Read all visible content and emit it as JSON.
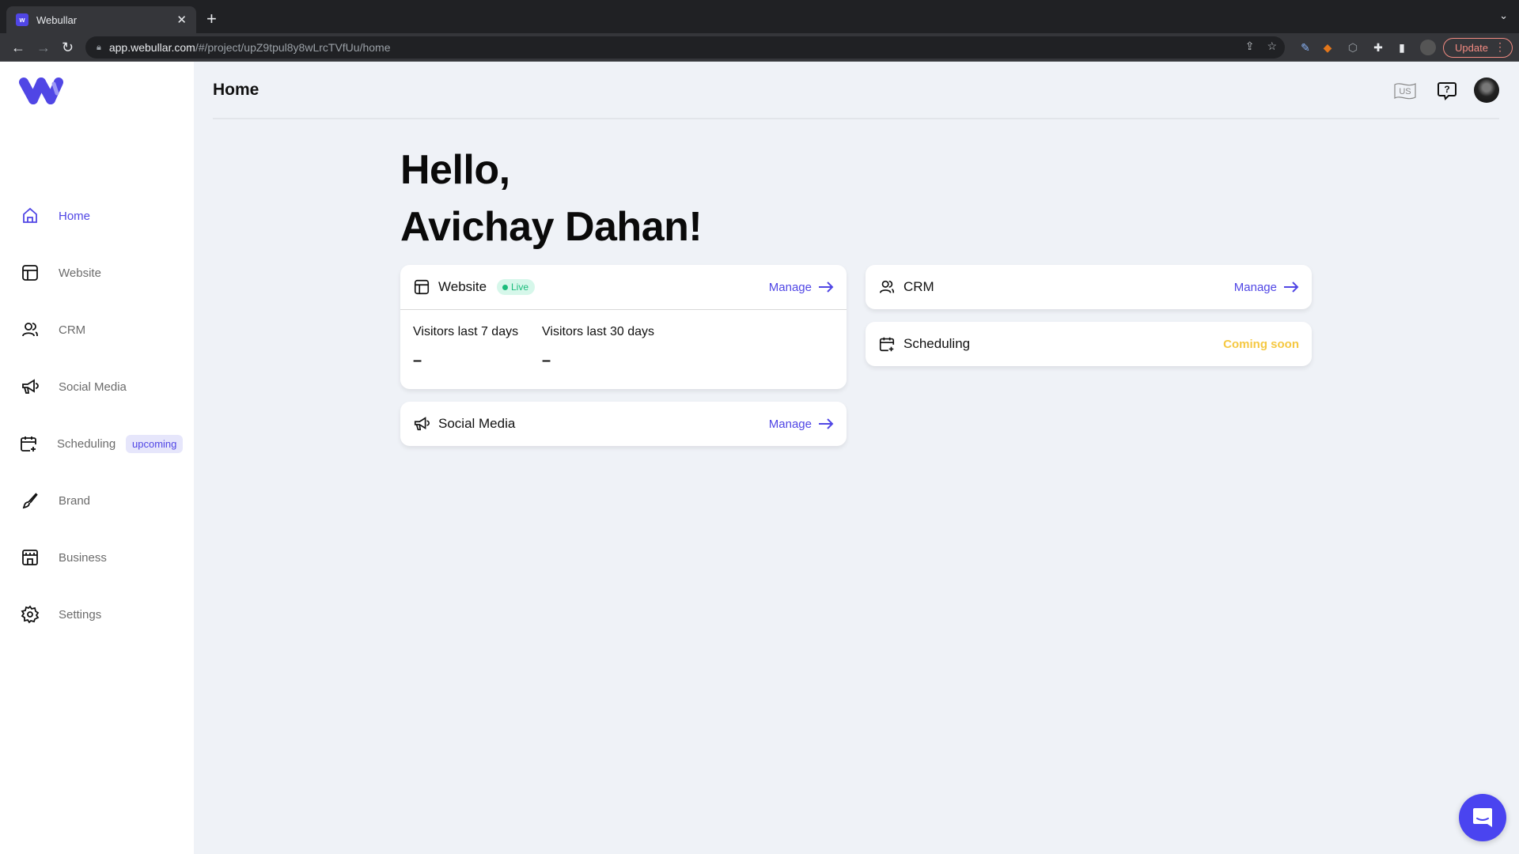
{
  "browser": {
    "tab_title": "Webullar",
    "favicon_letter": "w",
    "url_host": "app.webullar.com",
    "url_path": "/#/project/upZ9tpul8y8wLrcTVfUu/home",
    "update_label": "Update"
  },
  "sidebar": {
    "items": [
      {
        "label": "Home",
        "icon": "home-icon",
        "active": true
      },
      {
        "label": "Website",
        "icon": "layout-icon"
      },
      {
        "label": "CRM",
        "icon": "users-icon"
      },
      {
        "label": "Social Media",
        "icon": "megaphone-icon"
      },
      {
        "label": "Scheduling",
        "icon": "calendar-plus-icon",
        "badge": "upcoming"
      },
      {
        "label": "Brand",
        "icon": "brush-icon"
      },
      {
        "label": "Business",
        "icon": "store-icon"
      },
      {
        "label": "Settings",
        "icon": "gear-icon"
      }
    ]
  },
  "header": {
    "title": "Home",
    "language": "US"
  },
  "greeting": {
    "line1": "Hello,",
    "line2": "Avichay Dahan!"
  },
  "cards": {
    "website": {
      "title": "Website",
      "status": "Live",
      "action": "Manage",
      "stats": [
        {
          "label": "Visitors last 7 days",
          "value": "–"
        },
        {
          "label": "Visitors last 30 days",
          "value": "–"
        }
      ]
    },
    "social_media": {
      "title": "Social Media",
      "action": "Manage"
    },
    "crm": {
      "title": "CRM",
      "action": "Manage"
    },
    "scheduling": {
      "title": "Scheduling",
      "status": "Coming soon"
    }
  },
  "colors": {
    "accent": "#5046e5",
    "live": "#1abc7b",
    "coming_soon": "#f5c842",
    "background": "#eff2f7"
  }
}
